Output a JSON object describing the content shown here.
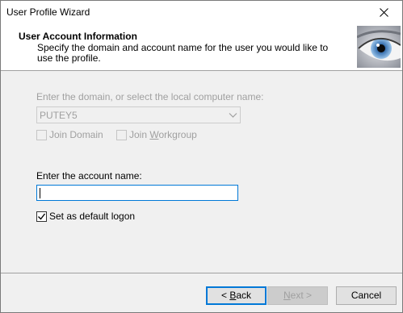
{
  "window": {
    "title": "User Profile Wizard"
  },
  "header": {
    "title": "User Account Information",
    "subtitle": "Specify the domain and account name for the user you would like to use the profile."
  },
  "domain": {
    "label": "Enter the domain, or select the local computer name:",
    "selected_value": "PUTEY5",
    "join_domain": "Join Domain",
    "join_workgroup_prefix": "Join ",
    "join_workgroup_accel": "W",
    "join_workgroup_rest": "orkgroup",
    "join_domain_checked": false,
    "join_workgroup_checked": false
  },
  "account": {
    "label": "Enter the account name:",
    "value": "",
    "default_logon_label": "Set as default logon",
    "default_logon_checked": true
  },
  "buttons": {
    "back_prefix": "< ",
    "back_accel": "B",
    "back_rest": "ack",
    "next_accel": "N",
    "next_rest": "ext >",
    "cancel": "Cancel"
  },
  "icons": {
    "close": "close-icon",
    "eye": "eye-icon",
    "dropdown": "chevron-down-icon",
    "check": "check-icon"
  },
  "colors": {
    "focus": "#0078d7",
    "disabled_text": "#a0a0a0"
  }
}
